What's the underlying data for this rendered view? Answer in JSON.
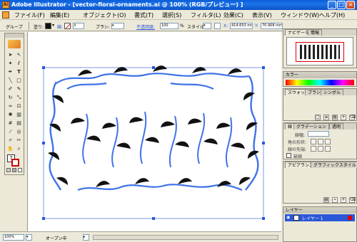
{
  "window": {
    "title": "Adobe Illustrator - [vector-floral-ornaments.ai @ 100% (RGB/プレビュー) ]",
    "app_icon": "Ai"
  },
  "menubar": {
    "items": [
      "ファイル(F)",
      "編集(E)",
      "オブジェクト(O)",
      "書式(T)",
      "選択(S)",
      "フィルタ(L)",
      "効果(C)",
      "表示(V)",
      "ウィンドウ(W)",
      "ヘルプ(H)"
    ]
  },
  "controlbar": {
    "group_label": "グループ",
    "fill_label": "塗り:",
    "stroke_label": "線:",
    "brush_label": "ブラシ:",
    "opacity_label": "不透明度:",
    "opacity_value": "100",
    "opacity_unit": "%",
    "style_label": "スタイル:",
    "x_label": "X:",
    "x_value": "414.653 mm",
    "y_label": "Y:",
    "y_value": "70.908 mm"
  },
  "statusbar": {
    "zoom": "100%",
    "status_text": "オープン中"
  },
  "panels": {
    "navigator": {
      "tabs": [
        "ナビゲータ",
        "情報"
      ]
    },
    "color": {
      "title": "カラー"
    },
    "swatches": {
      "tabs": [
        "スウォッチ",
        "ブラシ",
        "シンボル"
      ]
    },
    "stroke": {
      "tabs": [
        "線",
        "グラデーション",
        "透明"
      ],
      "width_label": "線幅:",
      "cap_label": "角の形状:",
      "join_label": "線の先端:",
      "dashed_label": "破線"
    },
    "appearance": {
      "tabs": [
        "アピアランス",
        "グラフィックスタイル"
      ]
    },
    "layers": {
      "title": "レイヤー",
      "layer_name": "レイヤー 1"
    }
  },
  "colors": {
    "accent": "#3f73e8",
    "selection": "#2a56d8",
    "xp_blue": "#0a5ed8"
  }
}
